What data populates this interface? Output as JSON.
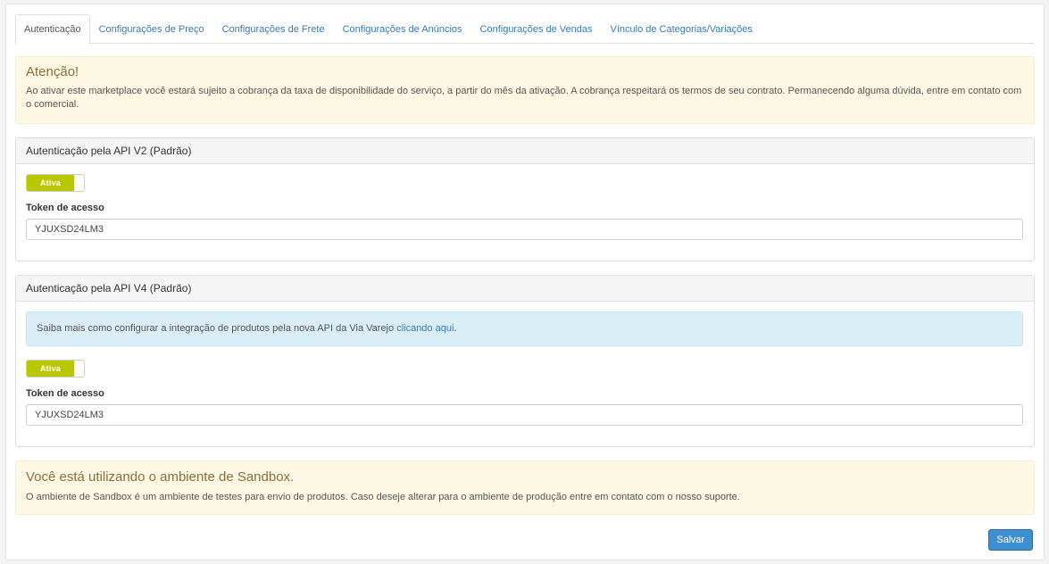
{
  "tabs": [
    {
      "label": "Autenticação",
      "active": true
    },
    {
      "label": "Configurações de Preço"
    },
    {
      "label": "Configurações de Frete"
    },
    {
      "label": "Configurações de Anúncios"
    },
    {
      "label": "Configurações de Vendas"
    },
    {
      "label": "Vínculo de Categorias/Variações"
    }
  ],
  "warning": {
    "title": "Atenção!",
    "text": "Ao ativar este marketplace você estará sujeito a cobrança da taxa de disponibilidade do serviço, a partir do mês da ativação. A cobrança respeitará os termos de seu contrato. Permanecendo alguma dúvida, entre em contato com o comercial."
  },
  "panel_v2": {
    "heading": "Autenticação pela API V2 (Padrão)",
    "toggle_label": "Ativa",
    "token_label": "Token de acesso",
    "token_value": "YJUXSD24LM3"
  },
  "panel_v4": {
    "heading": "Autenticação pela API V4 (Padrão)",
    "info_text": "Saiba mais como configurar a integração de produtos pela nova API da Via Varejo ",
    "info_link": "clicando aqui",
    "info_suffix": ".",
    "toggle_label": "Ativa",
    "token_label": "Token de acesso",
    "token_value": "YJUXSD24LM3"
  },
  "sandbox": {
    "title": "Você está utilizando o ambiente de Sandbox.",
    "text": "O ambiente de Sandbox é um ambiente de testes para envio de produtos. Caso deseje alterar para o ambiente de produção entre em contato com o nosso suporte."
  },
  "save_label": "Salvar",
  "colors": {
    "toggle_on": "#b8c700",
    "link": "#337ab7",
    "save_button": "#3d8fd1"
  }
}
